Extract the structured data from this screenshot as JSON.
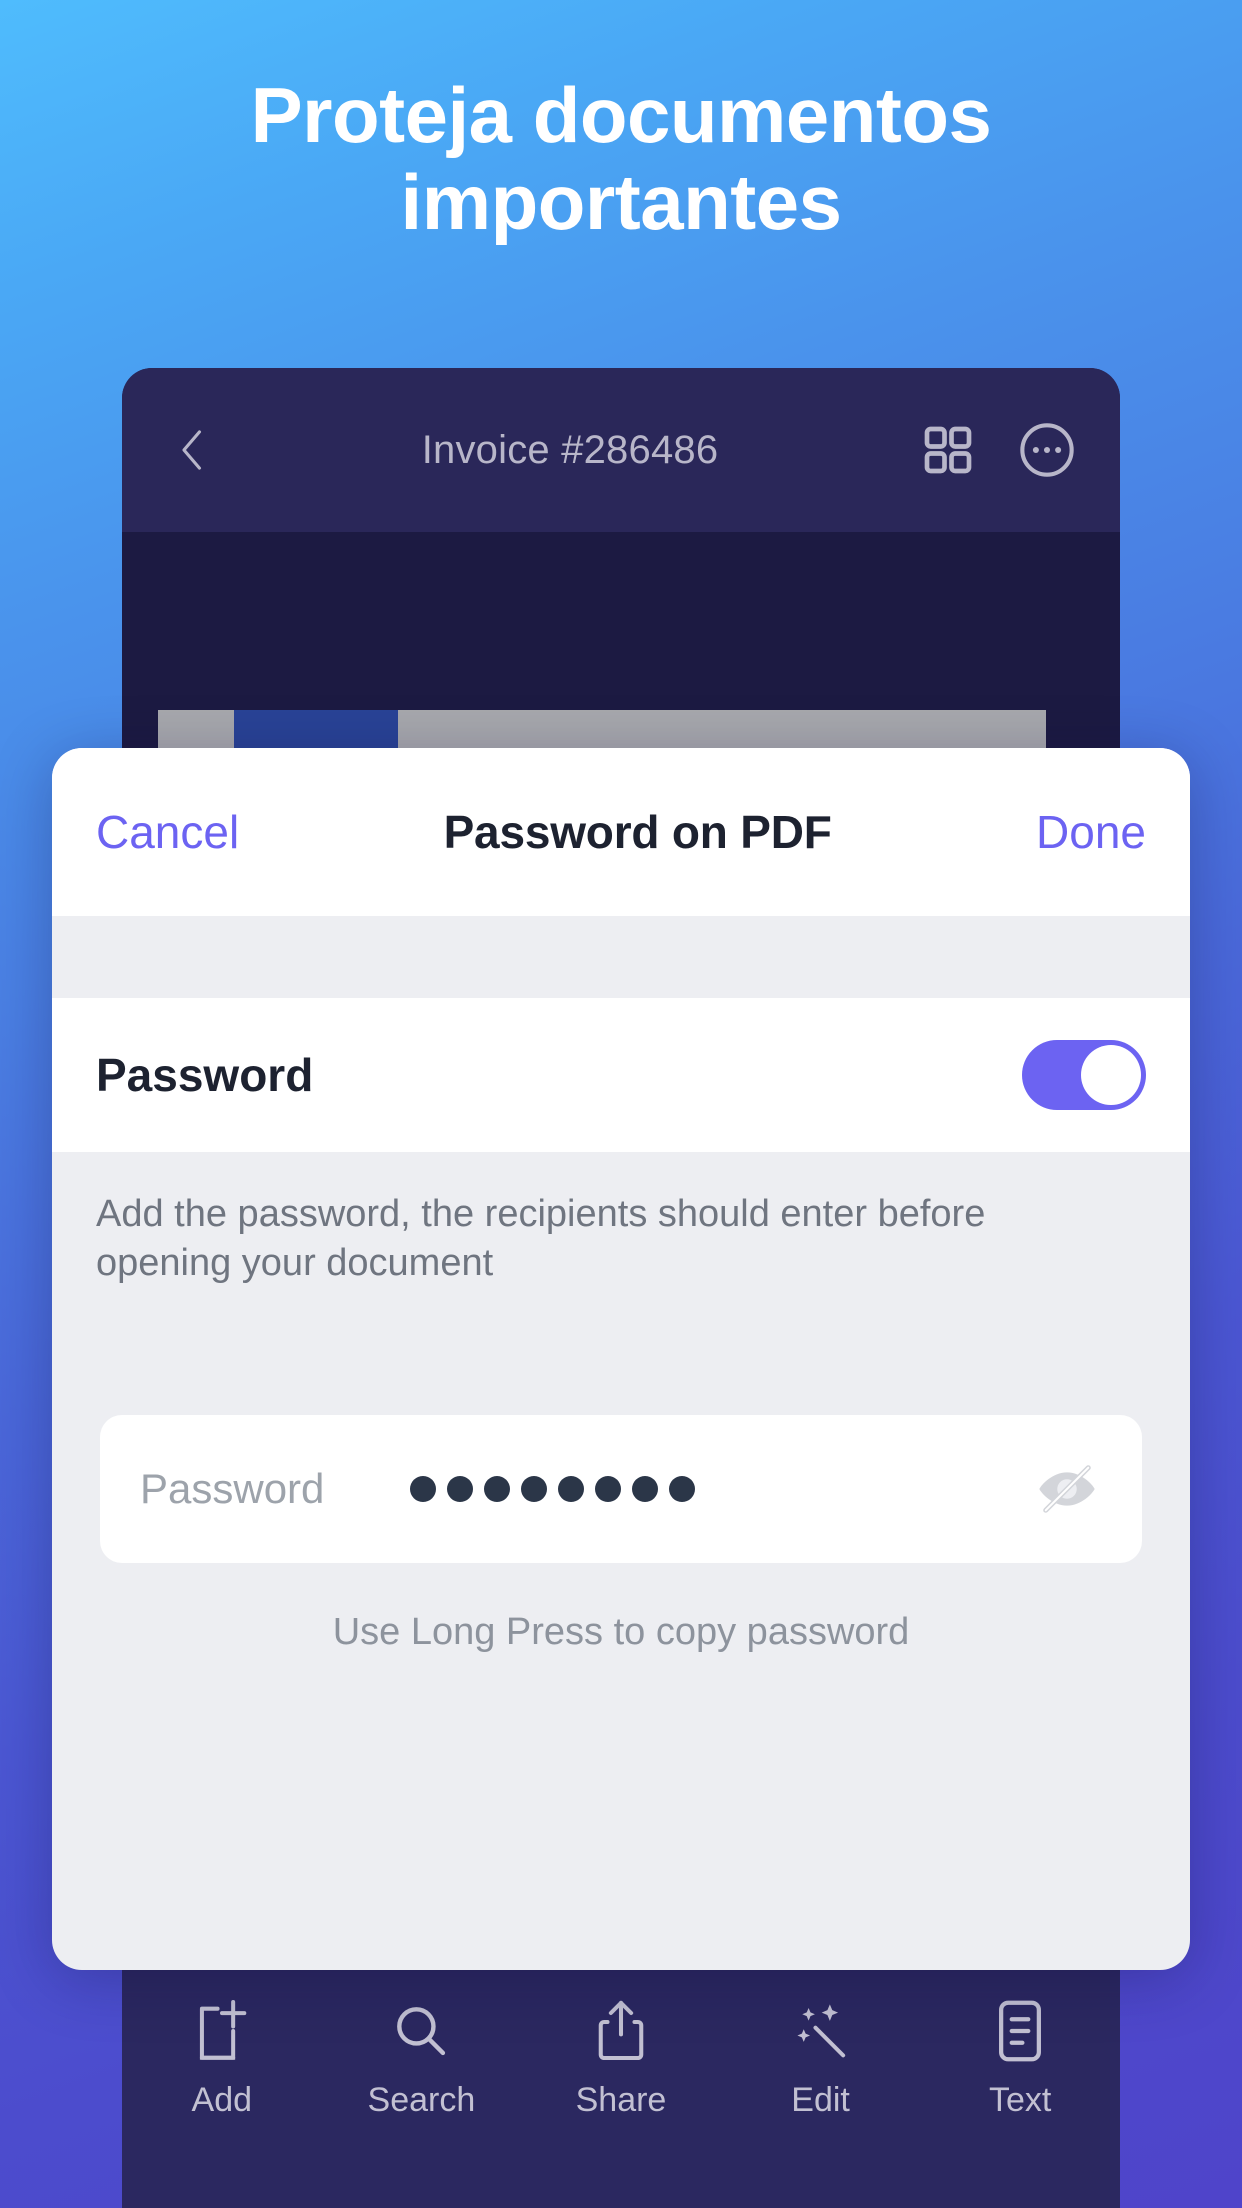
{
  "promo": {
    "headline": "Proteja documentos importantes"
  },
  "document_viewer": {
    "back_icon": "chevron-left-icon",
    "title": "Invoice #286486",
    "grid_icon": "grid-view-icon",
    "more_icon": "more-options-icon"
  },
  "toolbar": {
    "items": [
      {
        "label": "Add",
        "icon": "add-page-icon"
      },
      {
        "label": "Search",
        "icon": "search-icon"
      },
      {
        "label": "Share",
        "icon": "share-icon"
      },
      {
        "label": "Edit",
        "icon": "magic-wand-icon"
      },
      {
        "label": "Text",
        "icon": "text-document-icon"
      }
    ]
  },
  "modal": {
    "cancel_label": "Cancel",
    "title": "Password on PDF",
    "done_label": "Done",
    "password_row_label": "Password",
    "password_toggle_on": true,
    "helper_text": "Add the password, the recipients should enter before opening your document",
    "field": {
      "placeholder": "Password",
      "masked_dots": 8,
      "visibility_icon": "eye-slash-icon"
    },
    "hint_text": "Use Long Press to copy password"
  },
  "colors": {
    "accent_purple": "#6c63f2",
    "bg_top": "#4fbcfd",
    "bg_bottom": "#4f44ca",
    "phone_dark": "#262352",
    "sheet_gray": "#edeef2"
  }
}
